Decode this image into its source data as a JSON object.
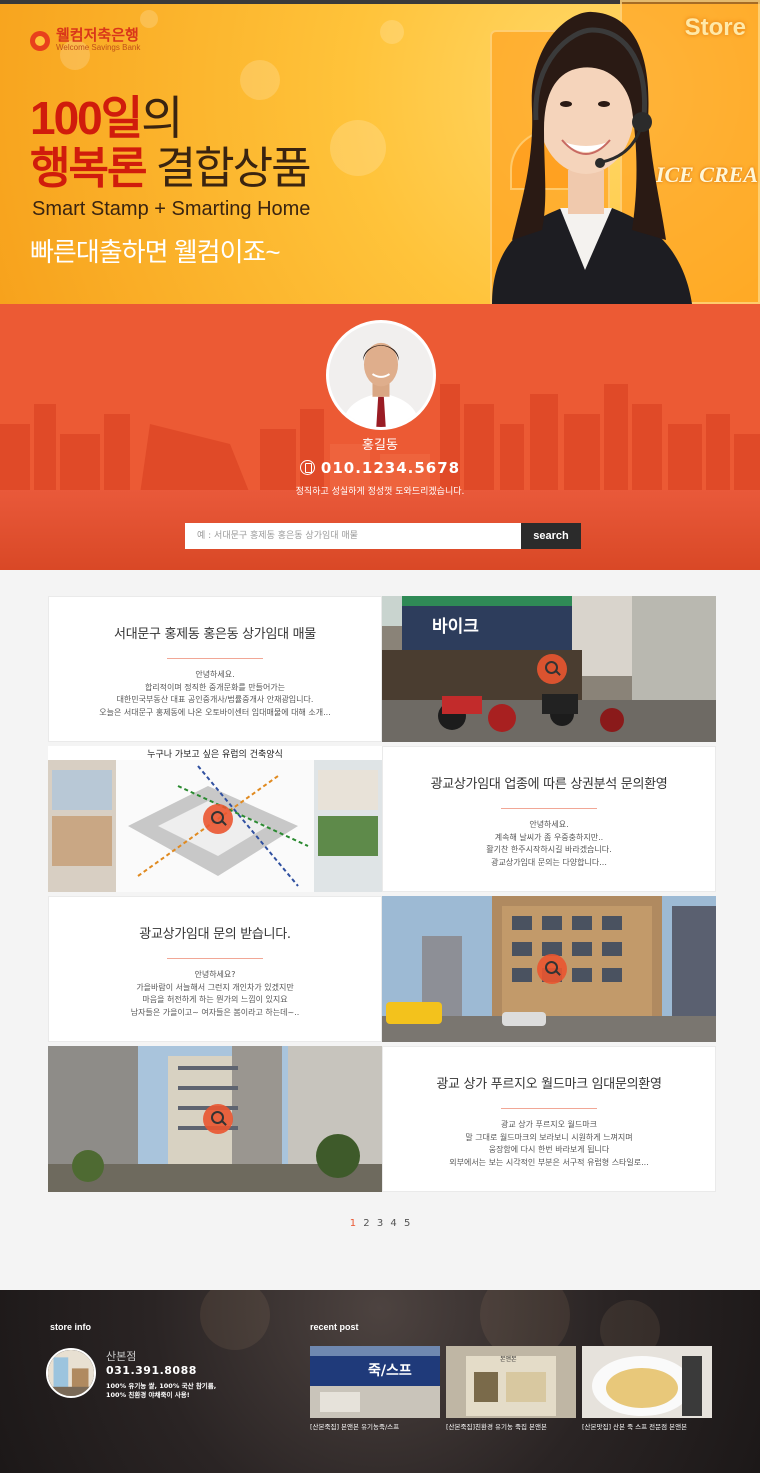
{
  "brand": {
    "name_ko": "웰컴저축은행",
    "name_en": "Welcome Savings Bank"
  },
  "hero": {
    "headline_1_em": "100일",
    "headline_1_rest": "의",
    "headline_2_em": "행복론",
    "headline_2_rest": " 결합상품",
    "subtitle": "Smart Stamp + Smarting Home",
    "tagline": "빠른대출하면 웰컴이죠~",
    "store_sign": "Store",
    "ice_sign": "ICE CREA"
  },
  "agent": {
    "name": "홍길동",
    "phone": "010.1234.5678",
    "message": "정직하고 성실하게 정성껏 도와드리겠습니다."
  },
  "search": {
    "placeholder": "예 : 서대문구 홍제동 홍은동 상가임대 매물",
    "button_label": "search"
  },
  "listings": [
    {
      "title": "서대문구 홍제동 홍은동 상가임대 매물",
      "lines": [
        "안녕하세요.",
        "합리적이며 정직한 중개문화를 만들어가는",
        "대한민국부동산 대표 공인중개사/법률중개사 안재광입니다.",
        "오늘은 서대문구 홍제동에 나온 오토바이센터 임대매물에 대해 소개..."
      ],
      "shop_sign": "바이크"
    },
    {
      "title": "광교상가임대 업종에 따른 상권분석 문의환영",
      "lines": [
        "안녕하세요.",
        "계속해 날씨가 좀 우중충하지만..",
        "활기찬 한주시작하시길 바라겠습니다.",
        "광교상가임대 문의는 다양합니다..."
      ],
      "sketch_caption": "누구나 가보고 싶은 유럽의 건축양식"
    },
    {
      "title": "광교상가임대 문의 받습니다.",
      "lines": [
        "안녕하세요?",
        "가을바람이 서늘해서 그런지 개인차가 있겠지만",
        "마음을 허전하게 하는 뭔가의 느낌이 있지요",
        "남자들은 가을이고~ 여자들은 봄이라고 하는데~.."
      ]
    },
    {
      "title": "광교 상가 푸르지오 월드마크 임대문의환영",
      "lines": [
        "광교 상가 푸르지오 월드마크",
        "말 그대로 월드마크의 보라보니 시원하게 느껴지며",
        "웅장함에 다시 한번 바라보게 됩니다",
        "외부에서는 보는 시각적인 부분은 서구적 유럽형 스타일로..."
      ]
    }
  ],
  "pagination": {
    "pages": [
      "1",
      "2",
      "3",
      "4",
      "5"
    ],
    "current": "1"
  },
  "footer": {
    "store_info_title": "store info",
    "store_name": "산본점",
    "store_phone": "031.391.8088",
    "store_desc_1": "100% 유기농 쌀, 100% 국산 참기름,",
    "store_desc_2": "100% 친환경 야채죽이 사용!",
    "recent_title": "recent post",
    "posts": [
      {
        "caption": "[산본죽집] 본앤본 유기농죽/스프",
        "sign": "죽/스프"
      },
      {
        "caption": "[산본죽집]친환경 유기농 죽집 본앤본",
        "sign": "본앤본"
      },
      {
        "caption": "[산본맛집] 산본 죽 스프 전문점 본앤본"
      }
    ]
  },
  "colors": {
    "accent": "#ea5530",
    "hero_red": "#d01c0c",
    "band": "#ec5a34",
    "footer": "#2a2424"
  },
  "icons": [
    "phone-icon",
    "zoom-icon",
    "logo-icon"
  ]
}
